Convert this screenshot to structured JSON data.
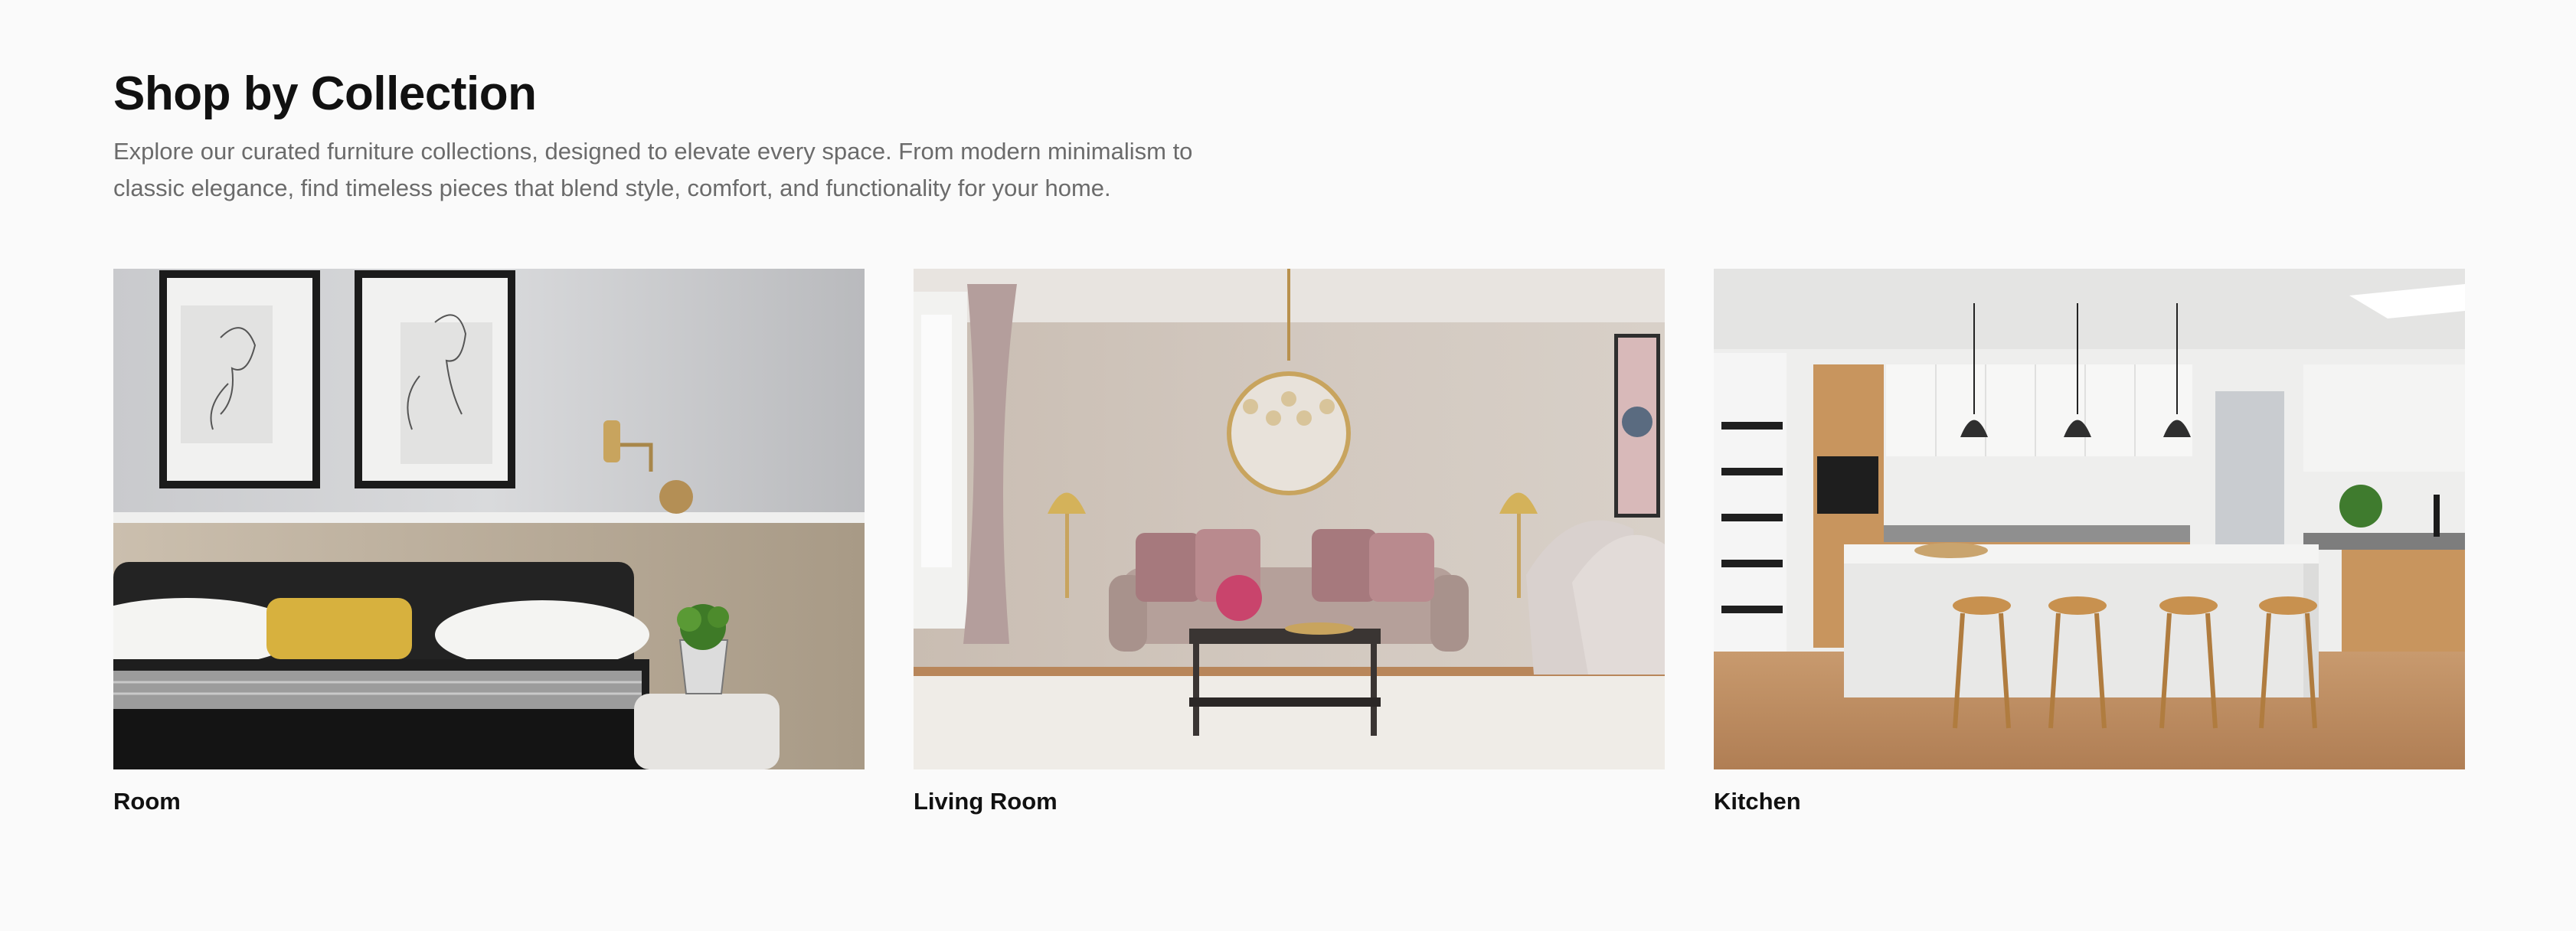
{
  "header": {
    "title": "Shop by Collection",
    "subtitle_line1": "Explore our curated furniture collections, designed to elevate every space. From modern minimalism to",
    "subtitle_line2": "classic elegance, find timeless pieces that blend style, comfort, and functionality for your home."
  },
  "collections": [
    {
      "label": "Room",
      "image": "bedroom-photo"
    },
    {
      "label": "Living Room",
      "image": "living-room-photo"
    },
    {
      "label": "Kitchen",
      "image": "kitchen-photo"
    }
  ]
}
